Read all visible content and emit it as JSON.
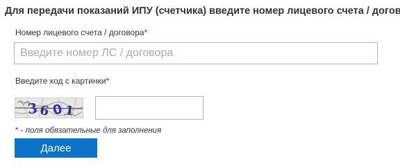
{
  "heading": "Для передачи показаний ИПУ (счетчика) введите номер лицевого счета / договора",
  "account": {
    "label": "Номер лицевого счета / договора",
    "required_mark": "*",
    "placeholder": "Введите номер ЛС / договора",
    "value": ""
  },
  "captcha": {
    "label": "Введите код с картинки",
    "required_mark": "*",
    "image_text": "3601",
    "value": ""
  },
  "note": {
    "mark": "*",
    "text": " - поля обязательные для заполнения"
  },
  "submit_label": "Далее",
  "colors": {
    "accent": "#0b74c8",
    "required": "#d9001b"
  }
}
